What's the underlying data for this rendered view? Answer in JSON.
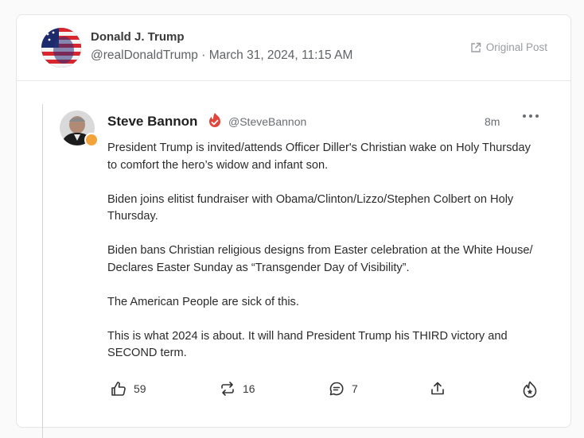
{
  "post": {
    "author_name": "Donald J. Trump",
    "author_handle": "@realDonaldTrump",
    "separator": "·",
    "timestamp": "March 31, 2024, 11:15 AM",
    "original_post_label": "Original Post"
  },
  "quoted": {
    "name": "Steve Bannon",
    "handle": "@SteveBannon",
    "time": "8m",
    "paragraphs": [
      "President Trump is invited/attends Officer Diller's Christian wake on Holy Thursday to comfort the hero’s widow and infant son.",
      "Biden joins elitist fundraiser with Obama/Clinton/Lizzo/Stephen Colbert on Holy Thursday.",
      "Biden bans Christian religious designs from Easter celebration at the White House/ Declares Easter Sunday as “Transgender Day of Visibility”.",
      "The American People are sick of this.",
      "This is what 2024 is about. It will hand President Trump his THIRD victory and SECOND term."
    ],
    "actions": {
      "likes": "59",
      "retruths": "16",
      "replies": "7"
    }
  },
  "icons": {
    "external_link": "external-link-icon",
    "verified": "verified-badge-icon",
    "more": "more-dots-icon",
    "like": "thumbs-up-icon",
    "retruth": "repost-icon",
    "reply": "comment-icon",
    "share": "share-icon",
    "boost": "droplet-icon"
  },
  "colors": {
    "verified_red": "#e0463c",
    "badge_gold": "#f2a33a",
    "muted": "#6a6d72"
  }
}
